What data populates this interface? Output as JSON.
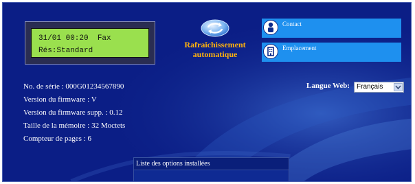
{
  "lcd": {
    "line1": "31/01 00:20  Fax",
    "line2": "Rés:Standard"
  },
  "refresh": {
    "label_line1": "Rafraîchissement",
    "label_line2": "automatique"
  },
  "links": {
    "contact": "Contact",
    "emplacement": "Emplacement"
  },
  "info": {
    "serial": "No. de série : 000G01234567890",
    "firmware": "Version du firmware : V",
    "firmware_supp": "Version du firmware supp. : 0.12",
    "memory": "Taille de la mémoire : 32 Moctets",
    "pages": "Compteur de pages : 6"
  },
  "language": {
    "label": "Langue Web:",
    "selected": "Français"
  },
  "options": {
    "header": "Liste des options installées"
  },
  "colors": {
    "background": "#0b1e86",
    "accent": "#1e90ef",
    "lcd": "#9ae04e",
    "refresh_text": "#ffb20d"
  }
}
